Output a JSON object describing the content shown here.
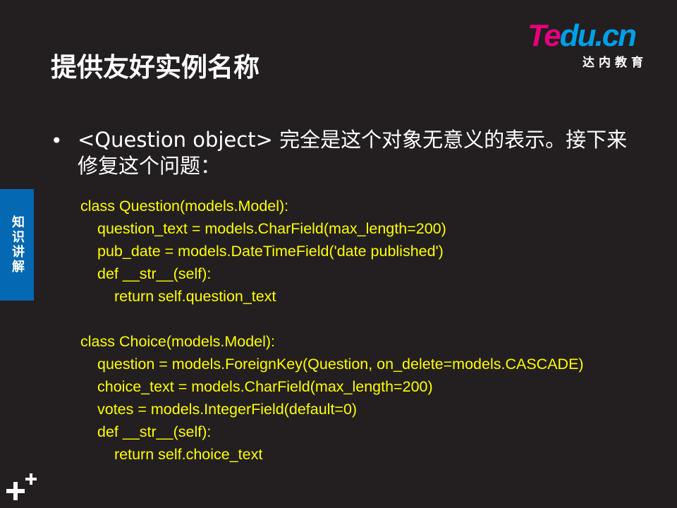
{
  "header": {
    "title": "提供友好实例名称",
    "logo": {
      "part1": "Te",
      "part2": "du.cn",
      "subtitle": "达内教育",
      "colors": {
        "pink": "#e6007e",
        "blue": "#00a0e9"
      }
    }
  },
  "side_tab": {
    "label": "知识讲解",
    "color": "#0568b3"
  },
  "bullet": {
    "marker": "•",
    "text": "<Question object> 完全是这个对象无意义的表示。接下来修复这个问题："
  },
  "code": {
    "color": "#ffff00",
    "lines": [
      "class Question(models.Model):",
      "question_text = models.CharField(max_length=200)",
      "pub_date = models.DateTimeField('date published')",
      "def __str__(self):",
      "return self.question_text",
      "",
      "class Choice(models.Model):",
      "question = models.ForeignKey(Question, on_delete=models.CASCADE)",
      "choice_text = models.CharField(max_length=200)",
      "votes = models.IntegerField(default=0)",
      "def __str__(self):",
      "return self.choice_text"
    ]
  },
  "footer": {
    "icon": "plus-icon"
  }
}
